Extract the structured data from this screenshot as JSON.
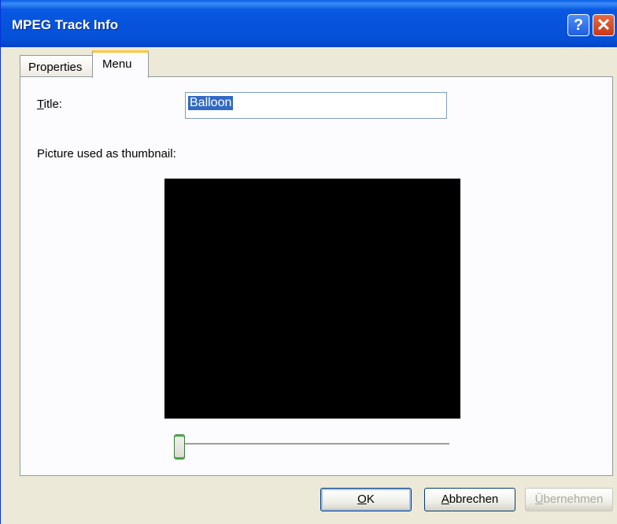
{
  "window": {
    "title": "MPEG Track Info",
    "help_glyph": "?",
    "close_glyph": "✕"
  },
  "tabs": [
    {
      "label": "Properties",
      "active": false
    },
    {
      "label": "Menu",
      "active": true
    }
  ],
  "menu_tab": {
    "title_label_mnemonic": "T",
    "title_label_rest": "itle:",
    "title_value": "Balloon",
    "thumbnail_label": "Picture used as thumbnail:",
    "thumbnail_slider_position": 0
  },
  "buttons": {
    "ok_mnemonic": "O",
    "ok_rest": "K",
    "cancel_mnemonic": "A",
    "cancel_rest": "bbrechen",
    "apply_mnemonic": "Ü",
    "apply_rest": "bernehmen"
  },
  "colors": {
    "titlebar": "#0553dc",
    "selection": "#316ac5",
    "active_tab_accent": "#ffc83c",
    "slider_accent": "#44b844"
  }
}
